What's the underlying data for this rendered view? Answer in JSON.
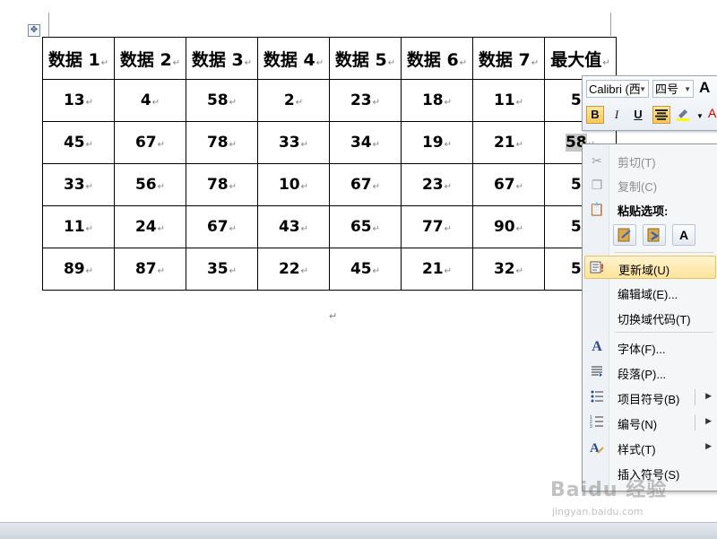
{
  "table": {
    "header": [
      "数据 1",
      "数据 2",
      "数据 3",
      "数据 4",
      "数据 5",
      "数据 6",
      "数据 7",
      "最大值"
    ],
    "rows": [
      [
        "13",
        "4",
        "58",
        "2",
        "23",
        "18",
        "11",
        "5"
      ],
      [
        "45",
        "67",
        "78",
        "33",
        "34",
        "19",
        "21",
        "58"
      ],
      [
        "33",
        "56",
        "78",
        "10",
        "67",
        "23",
        "67",
        "5"
      ],
      [
        "11",
        "24",
        "67",
        "43",
        "65",
        "77",
        "90",
        "5"
      ],
      [
        "89",
        "87",
        "35",
        "22",
        "45",
        "21",
        "32",
        "5"
      ]
    ],
    "cell_mark": "↵"
  },
  "paragraph_mark": "↵",
  "move_handle_icon": "move-handle-icon",
  "mini_toolbar": {
    "font_name": "Calibri (西",
    "font_size": "四号",
    "grow_font": "A",
    "bold": "B",
    "italic": "I",
    "underline": "U",
    "font_color": "A"
  },
  "context_menu": {
    "cut": "剪切(T)",
    "copy": "复制(C)",
    "paste_options": "粘贴选项:",
    "paste_buttons": [
      "keep-source-format",
      "merge-format",
      "A"
    ],
    "update_field": "更新域(U)",
    "edit_field": "编辑域(E)...",
    "toggle_field_codes": "切换域代码(T)",
    "font": "字体(F)...",
    "paragraph": "段落(P)...",
    "bullets": "项目符号(B)",
    "numbering": "编号(N)",
    "styles": "样式(T)",
    "insert_symbol": "插入符号(S)"
  },
  "watermark": {
    "logo": "Baidu 经验",
    "url": "jingyan.baidu.com"
  },
  "colors": {
    "highlight": "#fde49b",
    "menu_bg": "#f5f6f7",
    "font_color_red": "#cc0000"
  }
}
